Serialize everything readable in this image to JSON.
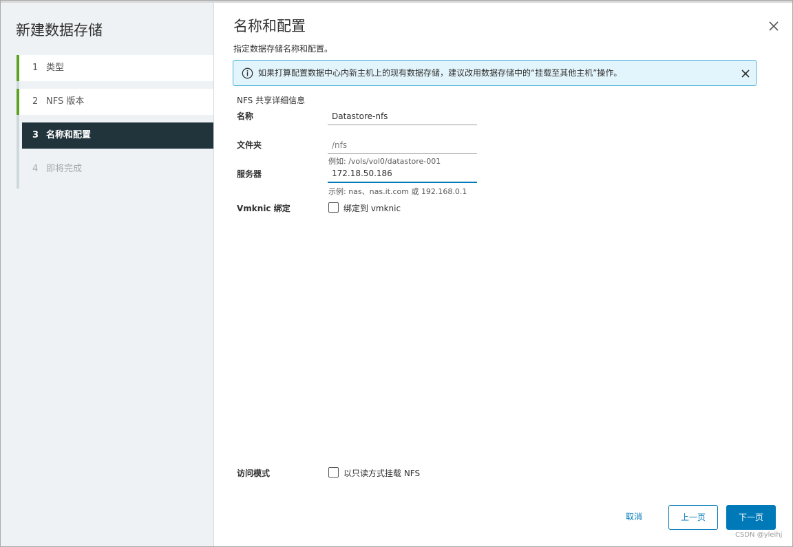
{
  "wizard": {
    "title": "新建数据存储",
    "steps": [
      {
        "num": "1",
        "label": "类型",
        "state": "done"
      },
      {
        "num": "2",
        "label": "NFS 版本",
        "state": "done"
      },
      {
        "num": "3",
        "label": "名称和配置",
        "state": "active"
      },
      {
        "num": "4",
        "label": "即将完成",
        "state": "pending"
      }
    ]
  },
  "page": {
    "title": "名称和配置",
    "subtitle": "指定数据存储名称和配置。"
  },
  "alert": {
    "text": "如果打算配置数据中心内新主机上的现有数据存储，建议改用数据存储中的“挂载至其他主机”操作。",
    "icon": "info-icon"
  },
  "form": {
    "section_title": "NFS 共享详细信息",
    "name_label": "名称",
    "name_value": "Datastore-nfs",
    "folder_label": "文件夹",
    "folder_placeholder": "/nfs",
    "folder_hint": "例如: /vols/vol0/datastore-001",
    "server_label": "服务器",
    "server_value": "172.18.50.186",
    "server_hint": "示例: nas、nas.it.com 或 192.168.0.1",
    "vmknic_label": "Vmknic 绑定",
    "vmknic_checkbox_label": "绑定到 vmknic",
    "access_label": "访问模式",
    "access_checkbox_label": "以只读方式挂载 NFS"
  },
  "footer": {
    "cancel_label": "取消",
    "back_label": "上一页",
    "next_label": "下一页"
  },
  "colors": {
    "accent": "#0079b8",
    "active_step_bg": "#21333b",
    "done_step_bar": "#5aa220",
    "alert_bg": "#e3f5fc",
    "alert_border": "#49afd9"
  },
  "watermark": "CSDN @yleihj"
}
